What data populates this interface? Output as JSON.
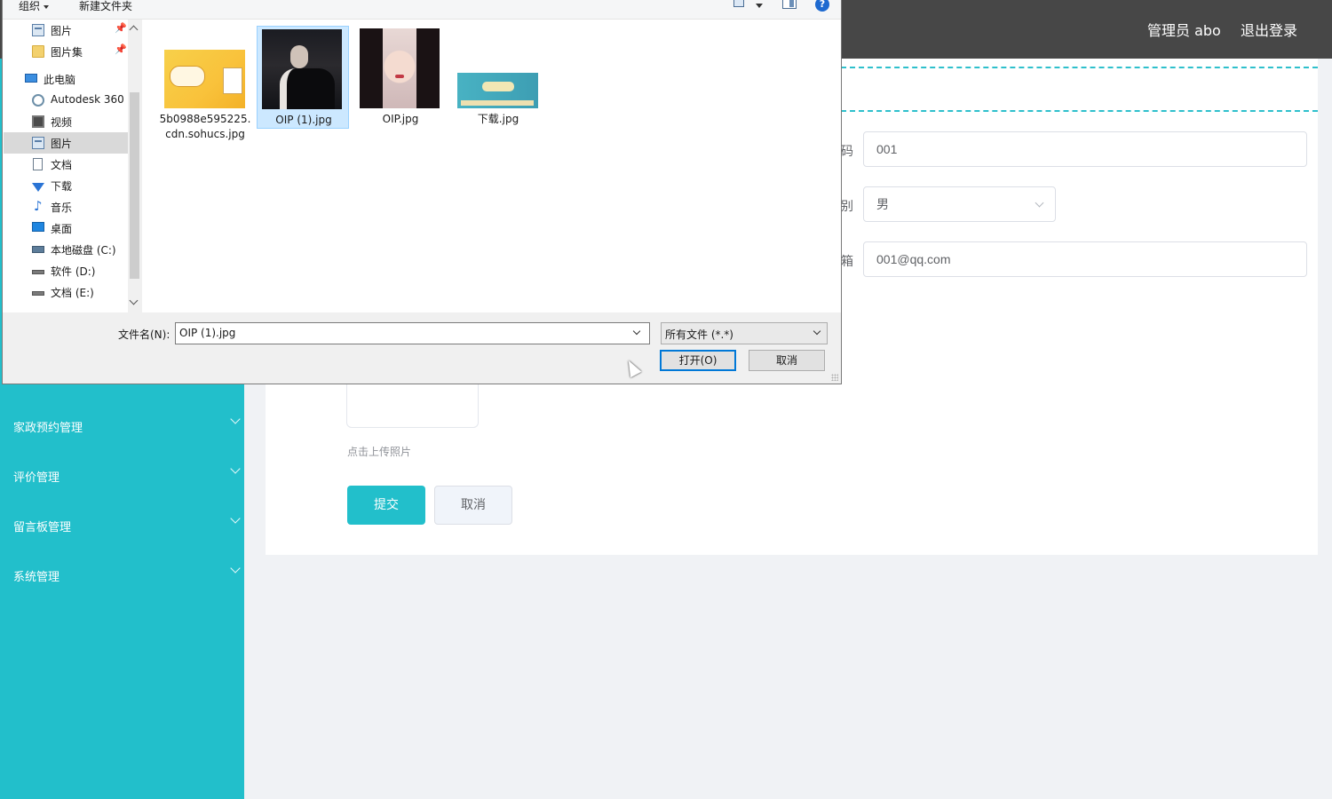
{
  "app": {
    "user_label": "管理员 abo",
    "logout_label": "退出登录"
  },
  "sidebar": {
    "items": [
      {
        "label": "家政预约管理"
      },
      {
        "label": "评价管理"
      },
      {
        "label": "留言板管理"
      },
      {
        "label": "系统管理"
      }
    ]
  },
  "form": {
    "fields": [
      {
        "label": "码",
        "value": "001"
      },
      {
        "label": "别",
        "value": "男"
      },
      {
        "label": "箱",
        "value": "001@qq.com"
      }
    ],
    "upload_tip": "点击上传照片",
    "submit_label": "提交",
    "cancel_label": "取消"
  },
  "dialog": {
    "toolbar": {
      "organize_label": "组织",
      "new_folder_label": "新建文件夹",
      "help_label": "?"
    },
    "nav": [
      {
        "label": "图片",
        "icon": "picture-icon",
        "pinned": true
      },
      {
        "label": "图片集",
        "icon": "folder-icon",
        "pinned": true
      },
      {
        "label": "此电脑",
        "icon": "computer-icon",
        "pinned": false
      },
      {
        "label": "Autodesk 360",
        "icon": "cloud-icon",
        "pinned": false
      },
      {
        "label": "视频",
        "icon": "video-icon",
        "pinned": false
      },
      {
        "label": "图片",
        "icon": "picture-icon",
        "pinned": false,
        "selected": true
      },
      {
        "label": "文档",
        "icon": "document-icon",
        "pinned": false
      },
      {
        "label": "下载",
        "icon": "download-icon",
        "pinned": false
      },
      {
        "label": "音乐",
        "icon": "music-icon",
        "pinned": false
      },
      {
        "label": "桌面",
        "icon": "desktop-icon",
        "pinned": false
      },
      {
        "label": "本地磁盘 (C:)",
        "icon": "system-drive-icon",
        "pinned": false
      },
      {
        "label": "软件 (D:)",
        "icon": "drive-icon",
        "pinned": false
      },
      {
        "label": "文档 (E:)",
        "icon": "drive-icon",
        "pinned": false
      }
    ],
    "pin_glyph": "📌",
    "files": [
      {
        "name": "5b0988e595225.cdn.sohucs.jpg"
      },
      {
        "name": "OIP (1).jpg",
        "selected": true
      },
      {
        "name": "OIP.jpg"
      },
      {
        "name": "下载.jpg"
      }
    ],
    "filename_label": "文件名(N):",
    "filename_value": "OIP (1).jpg",
    "filetype_value": "所有文件 (*.*)",
    "open_label": "打开(O)",
    "cancel_label": "取消"
  },
  "colors": {
    "accent": "#22bfcb",
    "topbar": "#474747",
    "selection": "#cce8ff"
  }
}
